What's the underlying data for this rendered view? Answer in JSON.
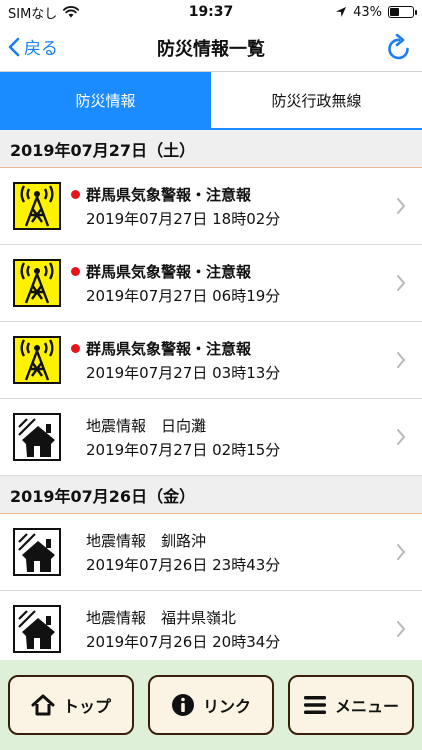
{
  "status_bar": {
    "carrier": "SIMなし",
    "time": "19:37",
    "battery_text": "43%",
    "battery_level": 0.43
  },
  "nav": {
    "back_label": "戻る",
    "title": "防災情報一覧"
  },
  "tabs": [
    {
      "label": "防災情報",
      "active": true
    },
    {
      "label": "防災行政無線",
      "active": false
    }
  ],
  "sections": [
    {
      "date": "2019年07月27日（土）",
      "items": [
        {
          "icon": "tower-icon",
          "unread": true,
          "title": "群馬県気象警報・注意報",
          "time": "2019年07月27日 18時02分"
        },
        {
          "icon": "tower-icon",
          "unread": true,
          "title": "群馬県気象警報・注意報",
          "time": "2019年07月27日 06時19分"
        },
        {
          "icon": "tower-icon",
          "unread": true,
          "title": "群馬県気象警報・注意報",
          "time": "2019年07月27日 03時13分"
        },
        {
          "icon": "earthquake-house-icon",
          "unread": false,
          "title": "地震情報　日向灘",
          "time": "2019年07月27日 02時15分"
        }
      ]
    },
    {
      "date": "2019年07月26日（金）",
      "items": [
        {
          "icon": "earthquake-house-icon",
          "unread": false,
          "title": "地震情報　釧路沖",
          "time": "2019年07月26日 23時43分"
        },
        {
          "icon": "earthquake-house-icon",
          "unread": false,
          "title": "地震情報　福井県嶺北",
          "time": "2019年07月26日 20時34分"
        }
      ]
    }
  ],
  "bottom_bar": {
    "top_label": "トップ",
    "link_label": "リンク",
    "menu_label": "メニュー"
  },
  "colors": {
    "accent": "#1a8cff",
    "link": "#1a7ef0",
    "unread": "#e8141a",
    "warning_icon_bg": "#fff200",
    "bottom_bg": "#dff0d8"
  }
}
